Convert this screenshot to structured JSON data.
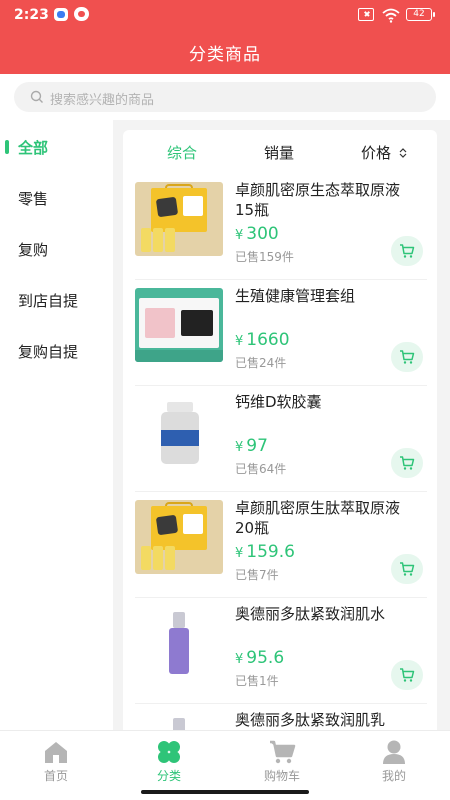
{
  "status_bar": {
    "time": "2:23",
    "battery": "42"
  },
  "header": {
    "title": "分类商品"
  },
  "search": {
    "placeholder": "搜索感兴趣的商品"
  },
  "sidebar": {
    "items": [
      {
        "label": "全部",
        "active": true
      },
      {
        "label": "零售"
      },
      {
        "label": "复购"
      },
      {
        "label": "到店自提"
      },
      {
        "label": "复购自提"
      }
    ]
  },
  "sort_tabs": [
    {
      "label": "综合",
      "active": true
    },
    {
      "label": "销量"
    },
    {
      "label": "价格"
    }
  ],
  "products": [
    {
      "name": "卓颜肌密原生态萃取原液15瓶",
      "currency": "¥",
      "price": "300",
      "sold": "已售159件",
      "image": "gift-box-image"
    },
    {
      "name": "生殖健康管理套组",
      "currency": "¥",
      "price": "1660",
      "sold": "已售24件",
      "image": "kit-image"
    },
    {
      "name": "钙维D软胶囊",
      "currency": "¥",
      "price": "97",
      "sold": "已售64件",
      "image": "bottle-image"
    },
    {
      "name": "卓颜肌密原生肽萃取原液20瓶",
      "currency": "¥",
      "price": "159.6",
      "sold": "已售7件",
      "image": "gift-box-image"
    },
    {
      "name": "奥德丽多肽紧致润肌水",
      "currency": "¥",
      "price": "95.6",
      "sold": "已售1件",
      "image": "purple-bottle-image"
    },
    {
      "name": "奥德丽多肽紧致润肌乳",
      "image": "purple-bottle-image"
    }
  ],
  "tabbar": [
    {
      "label": "首页",
      "icon": "home-icon"
    },
    {
      "label": "分类",
      "icon": "clover-icon",
      "active": true
    },
    {
      "label": "购物车",
      "icon": "cart-icon"
    },
    {
      "label": "我的",
      "icon": "user-icon"
    }
  ],
  "colors": {
    "header_red": "#f0504f",
    "accent_green": "#2ec478"
  }
}
